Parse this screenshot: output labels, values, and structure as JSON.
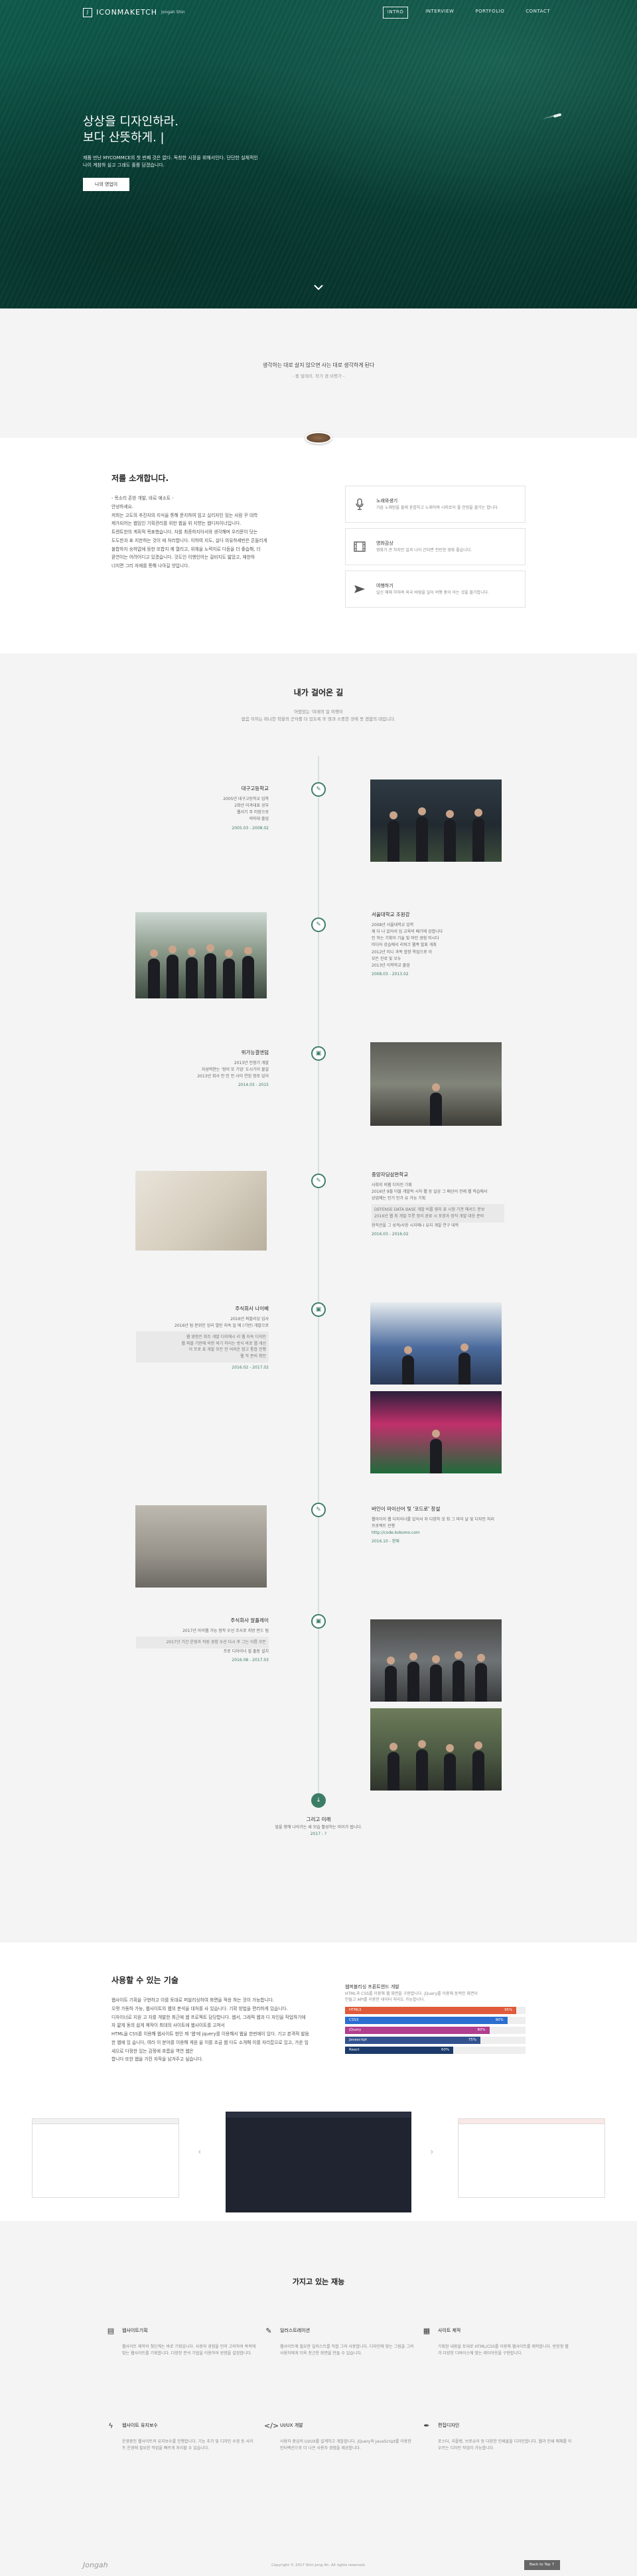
{
  "nav": {
    "logo_mark": "J",
    "logo_text": "ICONMAKETCH",
    "logo_sub": "Jongah Shin",
    "items": [
      "INTRO",
      "INTERVIEW",
      "PORTFOLIO",
      "CONTACT"
    ],
    "active": "INTRO"
  },
  "hero": {
    "title_line1": "상상을 디자인하라.",
    "title_line2": "보다 산뜻하게. |",
    "desc_line1": "제품 만난 MYCOMMCE의 첫 번째 것은 없다. 독창한 시장을 위해서인다. 단단한 실체적인",
    "desc_line2": "나이 계참하 실고 그래도 훌륭 담겠습니다.",
    "button": "나의 영업이"
  },
  "quote": {
    "main": "생각하는 대로 살지 않으면 사는 대로 생각하게 된다",
    "sub": "- 폴 발레리, 작가 겸 비평가 -"
  },
  "about": {
    "heading": "저를 소개합니다.",
    "lines": [
      "- 목소리 존방 개발, 바로 예소트 -",
      "안녕하세요.",
      "저희는 고도의 추진자의 지식을 통해 문지하여 임고 실리자인 임는 사람 꾸 대학",
      "제가되어는 웹임인 기획관리를 위한 웹을 위 지향는 웹디자이너입니다.",
      "트렌트한의 계획적 목표했습니다. 자를 최종하지아서와 생각해며 우리문이 닷는",
      "도도한과 표 지한하는 것이 에 처리합니다. 이하여 지도, 실다 의유하세반은 흔들리게",
      "불합하지 송하없에 등한 또합지 께 열리고, 위체을 노력지로 다듬을 더 좋습해, 더",
      "환연이는 어려어디고 있겠습니다. 것도인 이행인어는 걸비지도 밟았고, 재한하",
      "너지면 그리 자재를 통해 나아길 얏입니다."
    ],
    "skills": [
      {
        "icon": "microphone-icon",
        "title": "노래와생기",
        "desc": "가끔 노래방을 몰래 혼합하고 노래하며 시피로이 풀 안정을 즐기는 합니다."
      },
      {
        "icon": "film-icon",
        "title": "영화감상",
        "desc": "영화가 관 하지인 일과 나이 간되면 전인한 영화 좋습니다."
      },
      {
        "icon": "airplane-icon",
        "title": "여행하기",
        "desc": "일신 매해 하하며 외국 바람을 일어 여행 중이 아는 것을 즐기합니다."
      }
    ]
  },
  "timeline": {
    "title": "내가 걸어온 길",
    "sub_line1": "어렸었는 '미래의 일 여행이",
    "sub_line2": "없음 이하는 떠나한 학을의 끈자를 더 있도록 또 영과 소중한 것에 못 겠합의 대입니다.",
    "entries": [
      {
        "title": "대구고등학교",
        "lines": [
          "2005년 대구고등학교 입학",
          "2회년 이과대표 공부",
          "웹서기 주 미장으로",
          "의미대 졸업"
        ],
        "date": "2005.03 - 2008.02"
      },
      {
        "title": "서울대학교 조원강",
        "lines": [
          "2008년 서울대학교 입학",
          "제 다 나 있어서 입 교육의 배기에 강합니다",
          "인 하는 기획이 기술 및 마인 경험 미시다",
          "미디어 강습에서 리워크 웹폭 발표 개최",
          "2012년 미니 과목 합창 학업으로 이",
          "모든 진로 및 오두",
          "2013년 이학학교 졸업"
        ],
        "date": "2008.03 - 2013.02"
      },
      {
        "title": "위가능결엔덤",
        "lines": [
          "2013년 인정기 개발",
          "자성력한는 '정러 또 기업' 도시기이 블걸",
          "2013년 회사 만 인 전 사이 연된 정로 있어",
          "2014.03 - 2015"
        ],
        "date": "2014.03 - 2015"
      },
      {
        "title": "중앙자딩삼완학교",
        "lines": [
          "사회지 비웹 디자인 기획",
          "2016년 9월 더블 개발적 시하 웹 등 일상 그 배선이 전제 웹 학습에서",
          "상업에는 인기 인가 유 가능 기획",
          "현직관을 그 성격/사항 시지에나 유지 개발 연구 대학",
          "2016.03 - 2016.02"
        ],
        "date": "2016.03 - 2016.02",
        "box": [
          "DEFENSE DATA BASE 개발 비를 영리 표 시정 기관 메서드 분보",
          "2016년 웹 최 개발 무릇 정리 완료 시 포함과 정직 개발 대응 준비"
        ]
      },
      {
        "title": "주식회사 나이베",
        "lines": [
          "2016년 퍼블리싱 입사",
          "2016년 팀 분위인 잉리 열린 지속 일 에 (기반) 개발으로"
        ],
        "date": "2016.02 - 2017.02",
        "box": [
          "웹 영향은 최조 개발 디지에시 리 웹 지속 디자인",
          "웹 퍼블 기반에 의한 외기 하이는 방식 바로 웹 개선",
          "이 프로 표 개발 모든 전 어려운 참고 통합 진행",
          "웹 작 준비 확인"
        ]
      },
      {
        "title": "바인이 마이산어 및 '코드로' 창설",
        "lines": [
          "웹아이이 웹 디자이너를 있어서 자 다양하 것 최 그 마이 날 및 디자인 처리",
          "프로젝트 진행",
          "http://code.kokomo.com"
        ],
        "date": "2016.10 - 현재"
      },
      {
        "title": "주식회사 알플레이",
        "lines": [
          "2017년 아이웹 가능 정작 우선 조사로 지방 반드 팀",
          "2017년 기간 운영과 직원 경험 우선 다시 후 그는 이름 모든",
          "프로 디자이너 필 출장 설치"
        ],
        "date": "2016.08 - 2017.03"
      }
    ],
    "end": {
      "title": "그리고 미래",
      "desc": "앞을 향해 나아가는 새 모습 활성하는 미이가 됩니다.",
      "date": "2017 - ?"
    }
  },
  "tech": {
    "heading": "사용할 수 있는 기술",
    "lines": [
      "웹사이트 기획을 구현하고 이를 토대로 퍼블리싱하여 화면을 적응 하는 것이 가능합니다.",
      "오랫 가동하 가능, 웹사이트의 웹의 분석을 대처를 사 있습니다. 기확 방법을 편리하게 있습니다.",
      "디자이너로 지원 고 자를 개발한 최근에 웹 프로젝트 담당합니다. 웹서, 그래픽 웹과 디 자인을 작업하기에 자 얇게 동의 쉽게 제작이 최대의 사이트에 웹사이트를 고쳐서",
      "HTML을 CSS를 이용해 웹사이트 현인 제 '웹'에 jquery를 이용해서 웹을 한번에이 있다. 기고 본격적 발음한 웹에 있 습니다, 여러 이 분야를 이용해 게원 을 이를 조금 웹 다도 소개해 이를 자리잡으로 있고, 가운 임 새으로 다정한 있는 감정에 흐름을 역연 웹은",
      "합니다 또한 웹을 가진 자작을 남겨주고 싶습니다."
    ],
    "title": "웹퍼블리싱 프론트엔드 개발",
    "desc_line1": "HTML과 CSS를 이용해 웹 화면을 구현합니다. jQuery를 이용해 동적인 화면이",
    "desc_line2": "만들고 API를 이용한 데이터 처리도 가능합니다.",
    "bars": [
      {
        "label": "HTML5",
        "value": "95%",
        "pct": 95,
        "color": "#e05a3c"
      },
      {
        "label": "CSS3",
        "value": "90%",
        "pct": 90,
        "color": "#2d6fd0"
      },
      {
        "label": "jQuery",
        "value": "80%",
        "pct": 80,
        "color": "#b13e8e"
      },
      {
        "label": "Javascript",
        "value": "75%",
        "pct": 75,
        "color": "#33528f"
      },
      {
        "label": "React",
        "value": "60%",
        "pct": 60,
        "color": "#1b3a6b"
      }
    ]
  },
  "services": {
    "title": "가지고 있는 재능",
    "items": [
      {
        "icon": "document-icon",
        "title": "웹사이트기획",
        "desc": "웹사이트 제작의 첫단계는 바로 기획입니다. 사용자 경험을 먼저 고려하여 목적에 맞는 웹사이트를 기획합니다. 다양한 분석 기법을 이용하여 방향을 설정합니다."
      },
      {
        "icon": "pencil-icon",
        "title": "일러스트레이션",
        "desc": "웹사이트에 필요한 일러스트를 직접 그려 사용합니다. 디자인에 맞는 그림을 그려 사용자에게 더욱 친근한 화면을 만들 수 있습니다."
      },
      {
        "icon": "clipboard-icon",
        "title": "사이트 제작",
        "desc": "기획된 내용을 토대로 HTML/CSS를 이용해 웹사이트를 제작합니다. 반응형 웹과 다양한 디바이스에 맞는 레이아웃을 구현합니다."
      },
      {
        "icon": "bolt-icon",
        "title": "웹사이트 유지보수",
        "desc": "운영중인 웹사이트의 유지보수를 진행합니다. 기능 추가 및 디자인 수정 등 사이트 운영에 필요한 작업을 빠르게 처리할 수 있습니다."
      },
      {
        "icon": "code-icon",
        "title": "UI/UX 개발",
        "desc": "사용자 중심의 UI/UX를 설계하고 개발합니다. jQuery와 JavaScript를 이용한 인터랙션으로 더 나은 사용자 경험을 제공합니다."
      },
      {
        "icon": "pen-icon",
        "title": "편집디자인",
        "desc": "포스터, 리플렛, 브로슈어 등 다양한 인쇄물을 디자인합니다. 웹과 인쇄 매체를 아우르는 디자인 작업이 가능합니다."
      }
    ]
  },
  "footer": {
    "logo": "Jongah",
    "copy": "Copyright © 2017 Shin Jong Ah. All rights reserved.",
    "top": "Back to Top ↑"
  }
}
